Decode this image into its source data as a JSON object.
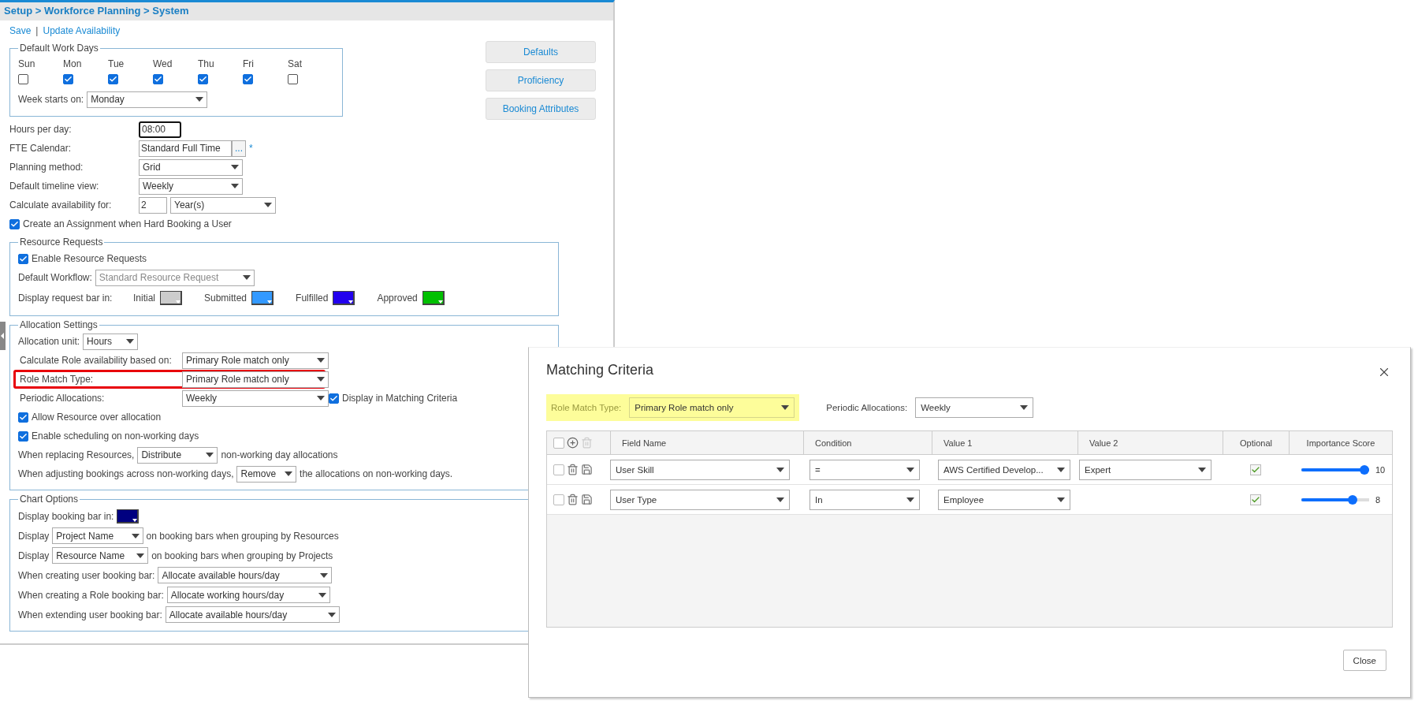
{
  "breadcrumb": "Setup > Workforce Planning > System",
  "actions": {
    "links": [
      "Save",
      "Update Availability"
    ],
    "separator": "|"
  },
  "side_buttons": [
    "Defaults",
    "Proficiency",
    "Booking Attributes"
  ],
  "work_days": {
    "title": "Default Work Days",
    "days": [
      {
        "label": "Sun",
        "checked": false
      },
      {
        "label": "Mon",
        "checked": true
      },
      {
        "label": "Tue",
        "checked": true
      },
      {
        "label": "Wed",
        "checked": true
      },
      {
        "label": "Thu",
        "checked": true
      },
      {
        "label": "Fri",
        "checked": true
      },
      {
        "label": "Sat",
        "checked": false
      }
    ],
    "week_starts": {
      "label": "Week starts on:",
      "value": "Monday"
    }
  },
  "general": [
    {
      "kind": "time",
      "label": "Hours per day:",
      "value": "08:00"
    },
    {
      "kind": "lookup",
      "label": "FTE Calendar:",
      "value": "Standard Full Time",
      "button": "...",
      "required_mark": "*"
    },
    {
      "kind": "select",
      "label": "Planning method:",
      "value": "Grid"
    },
    {
      "kind": "select",
      "label": "Default timeline view:",
      "value": "Weekly"
    },
    {
      "kind": "number_unit",
      "label": "Calculate availability for:",
      "value": "2",
      "unit": "Year(s)"
    },
    {
      "kind": "checkbox",
      "label": "Create an Assignment when Hard Booking a User",
      "checked": true
    }
  ],
  "resource_requests": {
    "title": "Resource Requests",
    "enable": {
      "label": "Enable Resource Requests",
      "checked": true
    },
    "workflow": {
      "label": "Default Workflow:",
      "value": "Standard Resource Request",
      "disabled": true
    },
    "bar_label": "Display request bar in:",
    "bar_colors": [
      {
        "label": "Initial",
        "color": "#cccccc"
      },
      {
        "label": "Submitted",
        "color": "#3399ff"
      },
      {
        "label": "Fulfilled",
        "color": "#2200ee"
      },
      {
        "label": "Approved",
        "color": "#00c000"
      }
    ]
  },
  "allocation": {
    "title": "Allocation Settings",
    "rows": [
      {
        "kind": "inline",
        "before": "Allocation unit:",
        "value": "Hours"
      },
      {
        "kind": "select",
        "label": "Calculate Role availability based on:",
        "value": "Primary Role match only",
        "highlighted": false
      },
      {
        "kind": "select",
        "label": "Role Match Type:",
        "value": "Primary Role match only",
        "highlighted": true
      },
      {
        "kind": "select",
        "label": "Periodic Allocations:",
        "value": "Weekly",
        "highlighted": false,
        "extra": {
          "label": "Display in Matching Criteria",
          "checked": true
        }
      },
      {
        "kind": "checkbox",
        "label": "Allow Resource over allocation",
        "checked": true
      },
      {
        "kind": "checkbox",
        "label": "Enable scheduling on non-working days",
        "checked": true
      },
      {
        "kind": "inline",
        "before": "When replacing Resources,",
        "value": "Distribute",
        "after": "non-working day allocations"
      },
      {
        "kind": "inline",
        "before": "When adjusting bookings across non-working days,",
        "value": "Remove",
        "after": "the allocations on non-working days."
      }
    ]
  },
  "chart_options": {
    "title": "Chart Options",
    "rows": [
      {
        "kind": "color",
        "label": "Display booking bar in:",
        "color": "#000080"
      },
      {
        "kind": "inline",
        "before": "Display",
        "value": "Project Name",
        "after": "on booking bars when grouping by Resources"
      },
      {
        "kind": "inline",
        "before": "Display",
        "value": "Resource Name",
        "after": "on booking bars when grouping by Projects"
      },
      {
        "kind": "inline",
        "before": "When creating user booking bar:",
        "value": "Allocate available hours/day"
      },
      {
        "kind": "inline",
        "before": "When creating a Role booking bar:",
        "value": "Allocate working hours/day"
      },
      {
        "kind": "inline",
        "before": "When extending user booking bar:",
        "value": "Allocate available hours/day"
      }
    ]
  },
  "dialog": {
    "title": "Matching Criteria",
    "filters": [
      {
        "label": "Role Match Type:",
        "value": "Primary Role match only",
        "highlighted": true
      },
      {
        "label": "Periodic Allocations:",
        "value": "Weekly",
        "highlighted": false
      }
    ],
    "select_all": false,
    "columns": [
      "Field Name",
      "Condition",
      "Value 1",
      "Value 2",
      "Optional",
      "Importance Score"
    ],
    "rows": [
      {
        "selected": false,
        "field": "User Skill",
        "condition": "=",
        "value_1": "AWS Certified Develop...",
        "value_2": "Expert",
        "optional": true,
        "level": 1.0,
        "score": "10"
      },
      {
        "selected": false,
        "field": "User Type",
        "condition": "In",
        "value_1": "Employee",
        "optional": true,
        "level": 0.8,
        "score": "8"
      }
    ],
    "close_button": "Close"
  }
}
